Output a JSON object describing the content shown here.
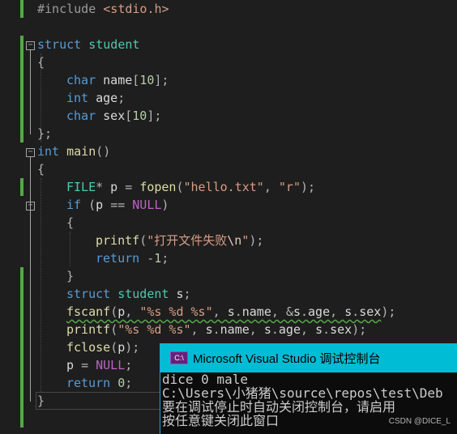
{
  "editor": {
    "lines": [
      {
        "tokens": [
          [
            "pre",
            "#include "
          ],
          [
            "str",
            "<stdio.h>"
          ]
        ]
      },
      {
        "tokens": []
      },
      {
        "tokens": [
          [
            "kw",
            "struct"
          ],
          [
            "id",
            " "
          ],
          [
            "type",
            "student"
          ]
        ]
      },
      {
        "tokens": [
          [
            "punc",
            "{"
          ]
        ]
      },
      {
        "tokens": [
          [
            "kw",
            "char"
          ],
          [
            "id",
            " name"
          ],
          [
            "punc",
            "["
          ],
          [
            "num",
            "10"
          ],
          [
            "punc",
            "];"
          ]
        ]
      },
      {
        "tokens": [
          [
            "kw",
            "int"
          ],
          [
            "id",
            " age"
          ],
          [
            "punc",
            ";"
          ]
        ]
      },
      {
        "tokens": [
          [
            "kw",
            "char"
          ],
          [
            "id",
            " sex"
          ],
          [
            "punc",
            "["
          ],
          [
            "num",
            "10"
          ],
          [
            "punc",
            "];"
          ]
        ]
      },
      {
        "tokens": [
          [
            "punc",
            "};"
          ]
        ]
      },
      {
        "tokens": [
          [
            "kw",
            "int"
          ],
          [
            "id",
            " "
          ],
          [
            "fn",
            "main"
          ],
          [
            "punc",
            "()"
          ]
        ]
      },
      {
        "tokens": [
          [
            "punc",
            "{"
          ]
        ]
      },
      {
        "tokens": [
          [
            "type",
            "FILE"
          ],
          [
            "punc",
            "*"
          ],
          [
            "id",
            " p "
          ],
          [
            "punc",
            "="
          ],
          [
            "id",
            " "
          ],
          [
            "fn",
            "fopen"
          ],
          [
            "punc",
            "("
          ],
          [
            "str",
            "\"hello.txt\""
          ],
          [
            "punc",
            ", "
          ],
          [
            "str",
            "\"r\""
          ],
          [
            "punc",
            ");"
          ]
        ]
      },
      {
        "tokens": [
          [
            "kw",
            "if"
          ],
          [
            "id",
            " "
          ],
          [
            "punc",
            "("
          ],
          [
            "id",
            "p "
          ],
          [
            "punc",
            "=="
          ],
          [
            "id",
            " "
          ],
          [
            "macro",
            "NULL"
          ],
          [
            "punc",
            ")"
          ]
        ]
      },
      {
        "tokens": [
          [
            "punc",
            "{"
          ]
        ]
      },
      {
        "tokens": [
          [
            "fn",
            "printf"
          ],
          [
            "punc",
            "("
          ],
          [
            "str",
            "\"打开文件失败"
          ],
          [
            "esc",
            "\\n"
          ],
          [
            "str",
            "\""
          ],
          [
            "punc",
            ");"
          ]
        ]
      },
      {
        "tokens": [
          [
            "kw",
            "return"
          ],
          [
            "id",
            " "
          ],
          [
            "punc",
            "-"
          ],
          [
            "num",
            "1"
          ],
          [
            "punc",
            ";"
          ]
        ]
      },
      {
        "tokens": [
          [
            "punc",
            "}"
          ]
        ]
      },
      {
        "tokens": [
          [
            "kw",
            "struct"
          ],
          [
            "id",
            " "
          ],
          [
            "type",
            "student"
          ],
          [
            "id",
            " s"
          ],
          [
            "punc",
            ";"
          ]
        ]
      },
      {
        "tokens": [
          [
            "fn",
            "fscanf",
            "sq"
          ],
          [
            "punc",
            "(",
            "sq"
          ],
          [
            "id",
            "p",
            "sq"
          ],
          [
            "punc",
            ", ",
            "sq"
          ],
          [
            "str",
            "\"%s %d %s\"",
            "sq"
          ],
          [
            "punc",
            ", ",
            "sq"
          ],
          [
            "id",
            "s",
            "sq"
          ],
          [
            "punc",
            ".",
            "sq"
          ],
          [
            "id",
            "name",
            "sq"
          ],
          [
            "punc",
            ", ",
            "sq"
          ],
          [
            "punc",
            "&",
            "sq"
          ],
          [
            "id",
            "s",
            "sq"
          ],
          [
            "punc",
            ".",
            "sq"
          ],
          [
            "id",
            "age",
            "sq"
          ],
          [
            "punc",
            ", ",
            "sq"
          ],
          [
            "id",
            "s",
            "sq"
          ],
          [
            "punc",
            ".",
            "sq"
          ],
          [
            "id",
            "sex",
            "sq"
          ],
          [
            "punc",
            ");"
          ]
        ]
      },
      {
        "tokens": [
          [
            "fn",
            "printf"
          ],
          [
            "punc",
            "("
          ],
          [
            "str",
            "\"%s %d %s\""
          ],
          [
            "punc",
            ", "
          ],
          [
            "id",
            "s"
          ],
          [
            "punc",
            "."
          ],
          [
            "id",
            "name"
          ],
          [
            "punc",
            ", "
          ],
          [
            "id",
            "s"
          ],
          [
            "punc",
            "."
          ],
          [
            "id",
            "age"
          ],
          [
            "punc",
            ", "
          ],
          [
            "id",
            "s"
          ],
          [
            "punc",
            "."
          ],
          [
            "id",
            "sex"
          ],
          [
            "punc",
            ");"
          ]
        ]
      },
      {
        "tokens": [
          [
            "fn",
            "fclose"
          ],
          [
            "punc",
            "("
          ],
          [
            "id",
            "p"
          ],
          [
            "punc",
            ");"
          ]
        ]
      },
      {
        "tokens": [
          [
            "id",
            "p "
          ],
          [
            "punc",
            "="
          ],
          [
            "id",
            " "
          ],
          [
            "macro",
            "NULL"
          ],
          [
            "punc",
            ";"
          ]
        ]
      },
      {
        "tokens": [
          [
            "kw",
            "return"
          ],
          [
            "id",
            " "
          ],
          [
            "num",
            "0"
          ],
          [
            "punc",
            ";"
          ]
        ]
      },
      {
        "tokens": [
          [
            "punc",
            "}"
          ]
        ]
      }
    ]
  },
  "console": {
    "title": "Microsoft Visual Studio 调试控制台",
    "icon_label": "C:\\",
    "output": [
      "dice 0 male",
      "C:\\Users\\小猪猪\\source\\repos\\test\\Deb",
      "要在调试停止时自动关闭控制台，请启用",
      "按任意键关闭此窗口"
    ]
  },
  "watermark": "CSDN @DICE_L"
}
